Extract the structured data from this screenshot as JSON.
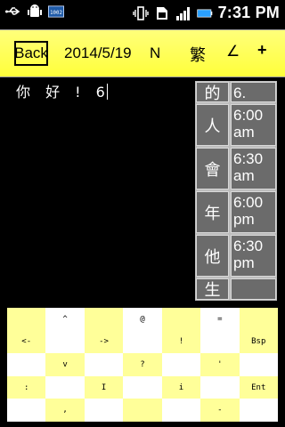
{
  "statusbar": {
    "icons": [
      "usb-icon",
      "android-debug-icon",
      "keyboard-icon"
    ],
    "right_icons": [
      "vibrate-icon",
      "sim-icon",
      "signal-icon",
      "battery-icon"
    ],
    "time": "7:31 PM"
  },
  "toolbar": {
    "back": "Back",
    "date": "2014/5/19",
    "n": "N",
    "trad": "繁",
    "angle": "∠",
    "plus": "+"
  },
  "editor": {
    "text": "你 好 ! 6"
  },
  "candidates": [
    {
      "char": "的",
      "value": "6."
    },
    {
      "char": "人",
      "value": "6:00 am"
    },
    {
      "char": "會",
      "value": "6:30 am"
    },
    {
      "char": "年",
      "value": "6:00 pm"
    },
    {
      "char": "他",
      "value": "6:30 pm"
    },
    {
      "char": "生",
      "value": ""
    }
  ],
  "keyboard": {
    "rows": [
      [
        "",
        "^",
        "",
        "@",
        "",
        "=",
        ""
      ],
      [
        "<-",
        "",
        "->",
        "",
        "!",
        "",
        "Bsp"
      ],
      [
        "",
        "v",
        "",
        "?",
        "",
        "'",
        ""
      ],
      [
        ":",
        "",
        "I",
        "",
        "i",
        "",
        "Ent"
      ],
      [
        "",
        ",",
        "",
        "",
        "",
        "-",
        ""
      ]
    ]
  },
  "colors": {
    "toolbar": "#ffff4a",
    "key_yellow": "#ffff99",
    "candidate_bg": "#6b6b6b"
  }
}
